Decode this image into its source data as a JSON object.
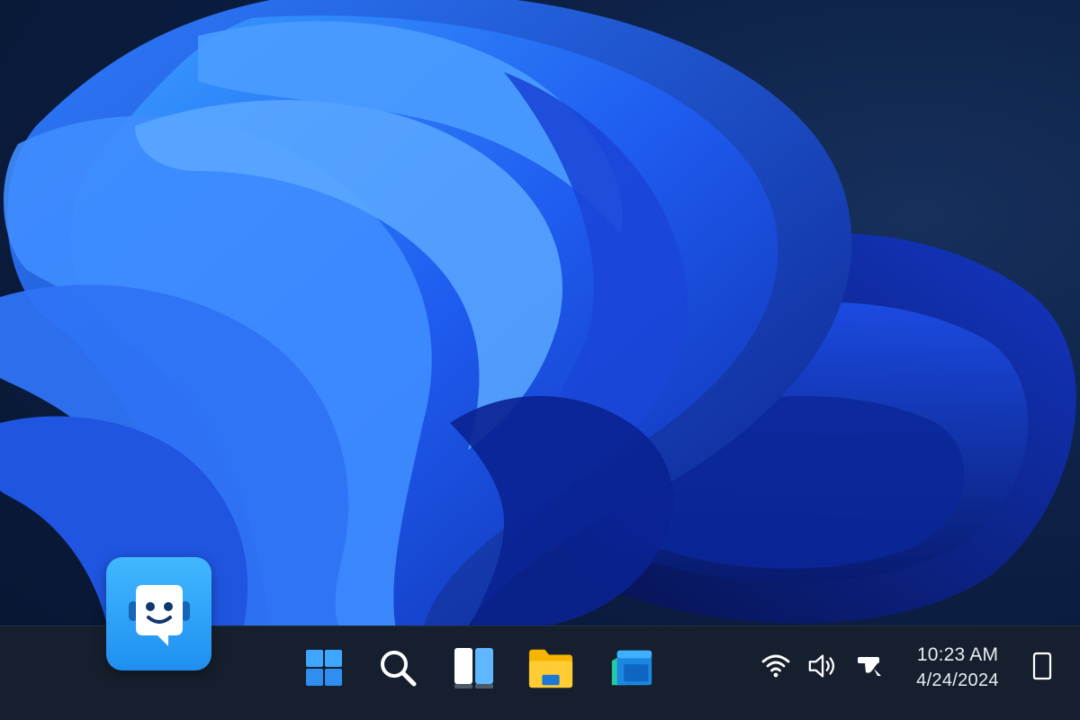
{
  "desktop": {
    "wallpaper": "bloom-wallpaper",
    "chat_app": {
      "icon": "chat-bot-icon",
      "color": "#2ea2f7"
    }
  },
  "taskbar": {
    "pinned": [
      {
        "name": "start-button",
        "icon": "windows-logo-icon"
      },
      {
        "name": "search-button",
        "icon": "search-icon"
      },
      {
        "name": "task-view-button",
        "icon": "task-view-icon"
      },
      {
        "name": "file-explorer-button",
        "icon": "folder-icon"
      },
      {
        "name": "app-button",
        "icon": "app-window-icon"
      }
    ],
    "tray": {
      "icons": [
        "wifi-icon",
        "volume-icon",
        "pen-icon"
      ],
      "clock": {
        "time": "10:23 AM",
        "date": "4/24/2024"
      },
      "notification_icon": "notification-icon"
    }
  }
}
